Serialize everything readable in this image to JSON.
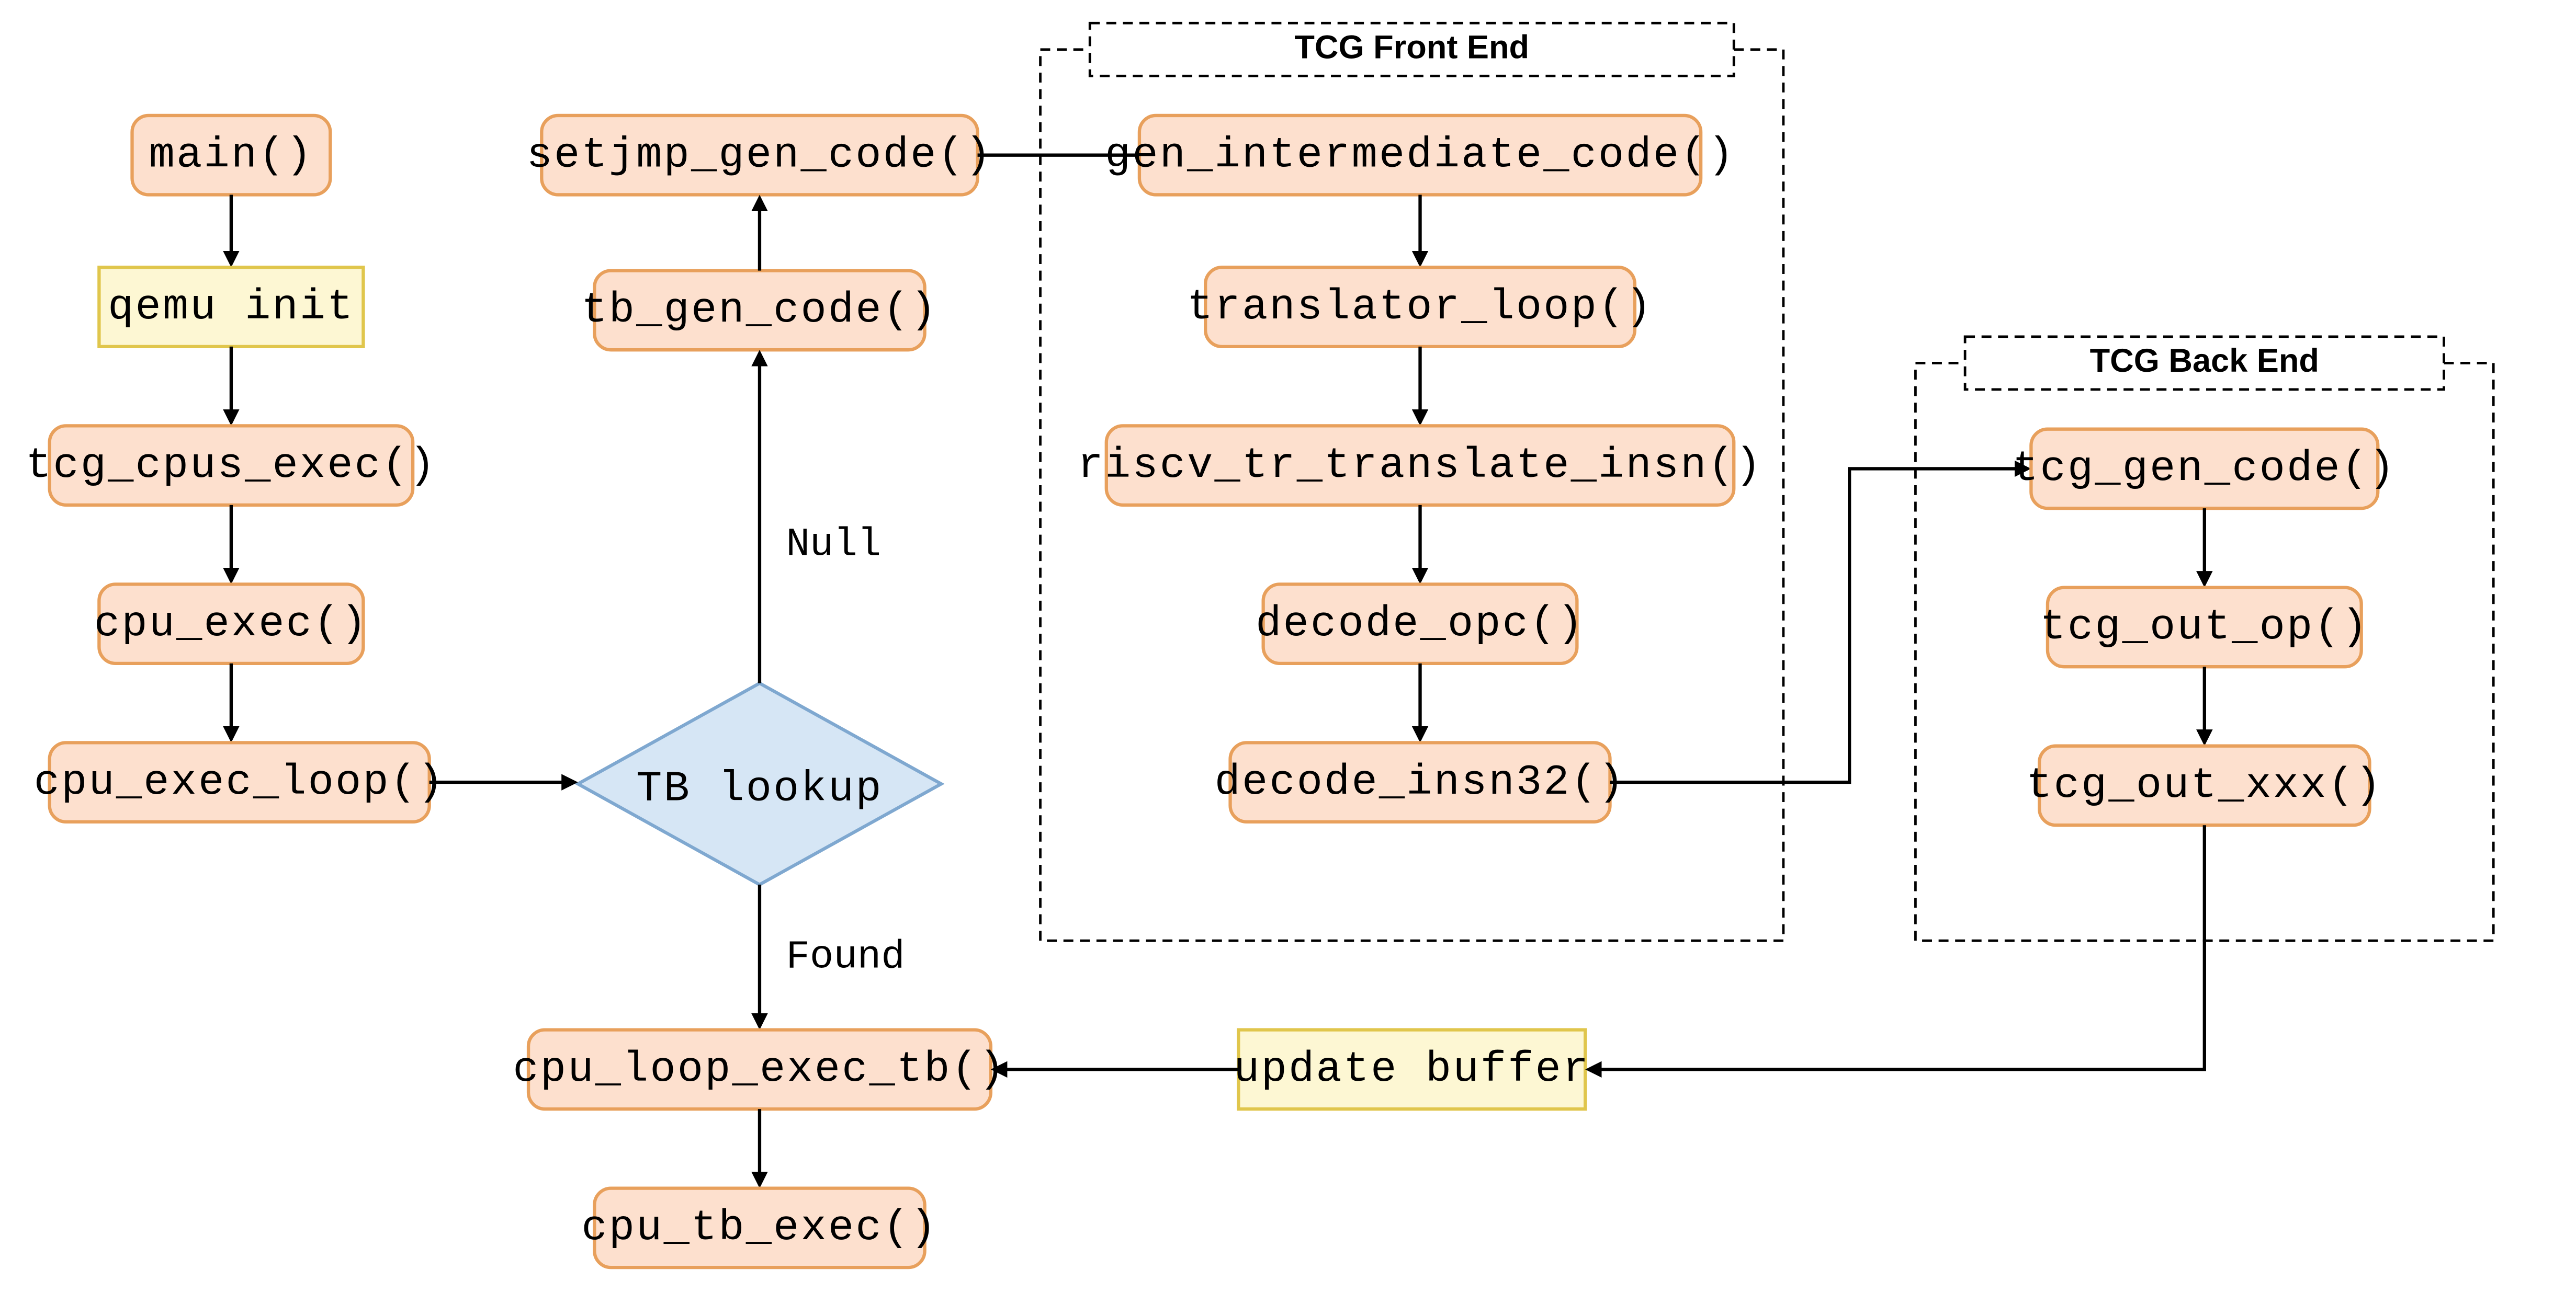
{
  "nodes": {
    "main": "main()",
    "qemu_init": "qemu init",
    "tcg_cpus": "tcg_cpus_exec()",
    "cpu_exec": "cpu_exec()",
    "cpu_loop": "cpu_exec_loop()",
    "tb_lookup": "TB lookup",
    "setjmp": "setjmp_gen_code()",
    "tb_gen": "tb_gen_code()",
    "cpu_loop_tb": "cpu_loop_exec_tb()",
    "cpu_tb_exec": "cpu_tb_exec()",
    "gen_inter": "gen_intermediate_code()",
    "trans_loop": "translator_loop()",
    "riscv_tr": "riscv_tr_translate_insn()",
    "decode_opc": "decode_opc()",
    "decode_i32": "decode_insn32()",
    "tcg_gen": "tcg_gen_code()",
    "tcg_out_op": "tcg_out_op()",
    "tcg_out_xxx": "tcg_out_xxx()",
    "update_buf": "update buffer"
  },
  "edge_labels": {
    "null": "Null",
    "found": "Found"
  },
  "groups": {
    "front": "TCG Front End",
    "back": "TCG Back End"
  }
}
